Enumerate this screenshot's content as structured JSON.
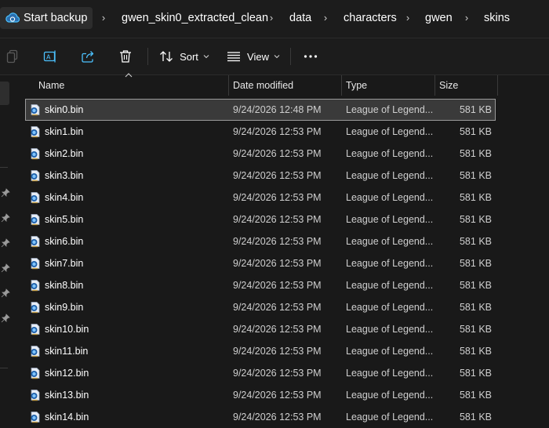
{
  "breadcrumb": {
    "items": [
      "Start backup",
      "gwen_skin0_extracted_clean",
      "data",
      "characters",
      "gwen",
      "skins"
    ],
    "separator": ">"
  },
  "toolbar": {
    "sort_label": "Sort",
    "view_label": "View",
    "more_label": "..."
  },
  "columns": {
    "name": "Name",
    "date_modified": "Date modified",
    "type": "Type",
    "size": "Size"
  },
  "files": [
    {
      "name": "skin0.bin",
      "date": "9/24/2026 12:48 PM",
      "type": "League of Legend...",
      "size": "581 KB",
      "selected": true
    },
    {
      "name": "skin1.bin",
      "date": "9/24/2026 12:53 PM",
      "type": "League of Legend...",
      "size": "581 KB"
    },
    {
      "name": "skin2.bin",
      "date": "9/24/2026 12:53 PM",
      "type": "League of Legend...",
      "size": "581 KB"
    },
    {
      "name": "skin3.bin",
      "date": "9/24/2026 12:53 PM",
      "type": "League of Legend...",
      "size": "581 KB"
    },
    {
      "name": "skin4.bin",
      "date": "9/24/2026 12:53 PM",
      "type": "League of Legend...",
      "size": "581 KB"
    },
    {
      "name": "skin5.bin",
      "date": "9/24/2026 12:53 PM",
      "type": "League of Legend...",
      "size": "581 KB"
    },
    {
      "name": "skin6.bin",
      "date": "9/24/2026 12:53 PM",
      "type": "League of Legend...",
      "size": "581 KB"
    },
    {
      "name": "skin7.bin",
      "date": "9/24/2026 12:53 PM",
      "type": "League of Legend...",
      "size": "581 KB"
    },
    {
      "name": "skin8.bin",
      "date": "9/24/2026 12:53 PM",
      "type": "League of Legend...",
      "size": "581 KB"
    },
    {
      "name": "skin9.bin",
      "date": "9/24/2026 12:53 PM",
      "type": "League of Legend...",
      "size": "581 KB"
    },
    {
      "name": "skin10.bin",
      "date": "9/24/2026 12:53 PM",
      "type": "League of Legend...",
      "size": "581 KB"
    },
    {
      "name": "skin11.bin",
      "date": "9/24/2026 12:53 PM",
      "type": "League of Legend...",
      "size": "581 KB"
    },
    {
      "name": "skin12.bin",
      "date": "9/24/2026 12:53 PM",
      "type": "League of Legend...",
      "size": "581 KB"
    },
    {
      "name": "skin13.bin",
      "date": "9/24/2026 12:53 PM",
      "type": "League of Legend...",
      "size": "581 KB"
    },
    {
      "name": "skin14.bin",
      "date": "9/24/2026 12:53 PM",
      "type": "League of Legend...",
      "size": "581 KB"
    }
  ],
  "icons": {
    "backup": "cloud-sync-icon",
    "copy": "copy-icon",
    "rename": "rename-icon",
    "share": "share-icon",
    "delete": "trash-icon",
    "sort": "sort-icon",
    "view": "view-icon",
    "more": "more-icon",
    "file": "league-file-icon",
    "pin": "pin-icon"
  },
  "colors": {
    "background": "#191919",
    "bar": "#1c1c1c",
    "accent": "#4cc2ff",
    "selection": "#3a3a3a"
  }
}
